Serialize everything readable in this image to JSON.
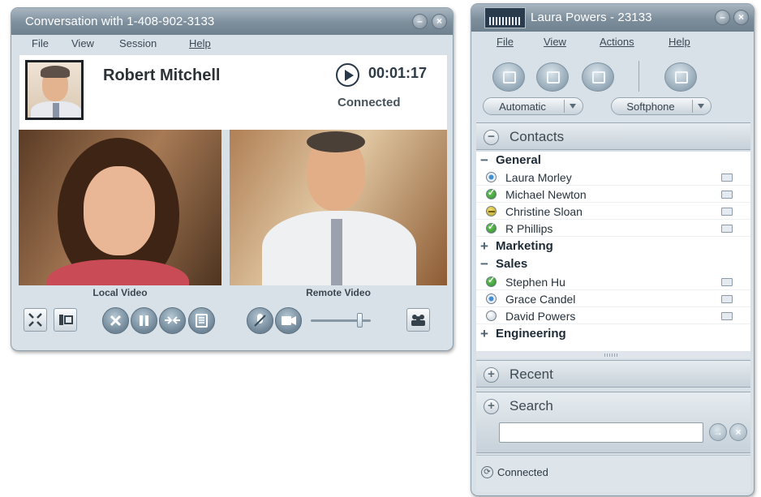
{
  "conversation": {
    "title": "Conversation with 1-408-902-3133",
    "menu": [
      "File",
      "View",
      "Session",
      "Help"
    ],
    "caller_name": "Robert Mitchell",
    "timer": "00:01:17",
    "status": "Connected",
    "local_video_label": "Local Video",
    "remote_video_label": "Remote Video",
    "volume_level": 0.82
  },
  "contacts_window": {
    "title": "Laura Powers - 23133",
    "menu": [
      "File",
      "View",
      "Actions",
      "Help"
    ],
    "presence_dropdown": "Automatic",
    "device_dropdown": "Softphone",
    "contacts_header": "Contacts",
    "groups": [
      {
        "name": "General",
        "expanded": true,
        "contacts": [
          {
            "name": "Laura Morley",
            "status": "blue"
          },
          {
            "name": "Michael Newton",
            "status": "available"
          },
          {
            "name": "Christine Sloan",
            "status": "busy"
          },
          {
            "name": "R Phillips",
            "status": "available"
          }
        ]
      },
      {
        "name": "Marketing",
        "expanded": false,
        "contacts": []
      },
      {
        "name": "Sales",
        "expanded": true,
        "contacts": [
          {
            "name": "Stephen Hu",
            "status": "available"
          },
          {
            "name": "Grace Candel",
            "status": "blue"
          },
          {
            "name": "David Powers",
            "status": "offline"
          }
        ]
      },
      {
        "name": "Engineering",
        "expanded": false,
        "contacts": []
      }
    ],
    "recent_header": "Recent",
    "search_header": "Search",
    "search_value": "",
    "connection_status": "Connected"
  },
  "colors": {
    "window_bg": "#d9e1e8",
    "titlebar": "#7d8e9c",
    "available": "#2f8a2a",
    "busy": "#d4bd3c"
  }
}
